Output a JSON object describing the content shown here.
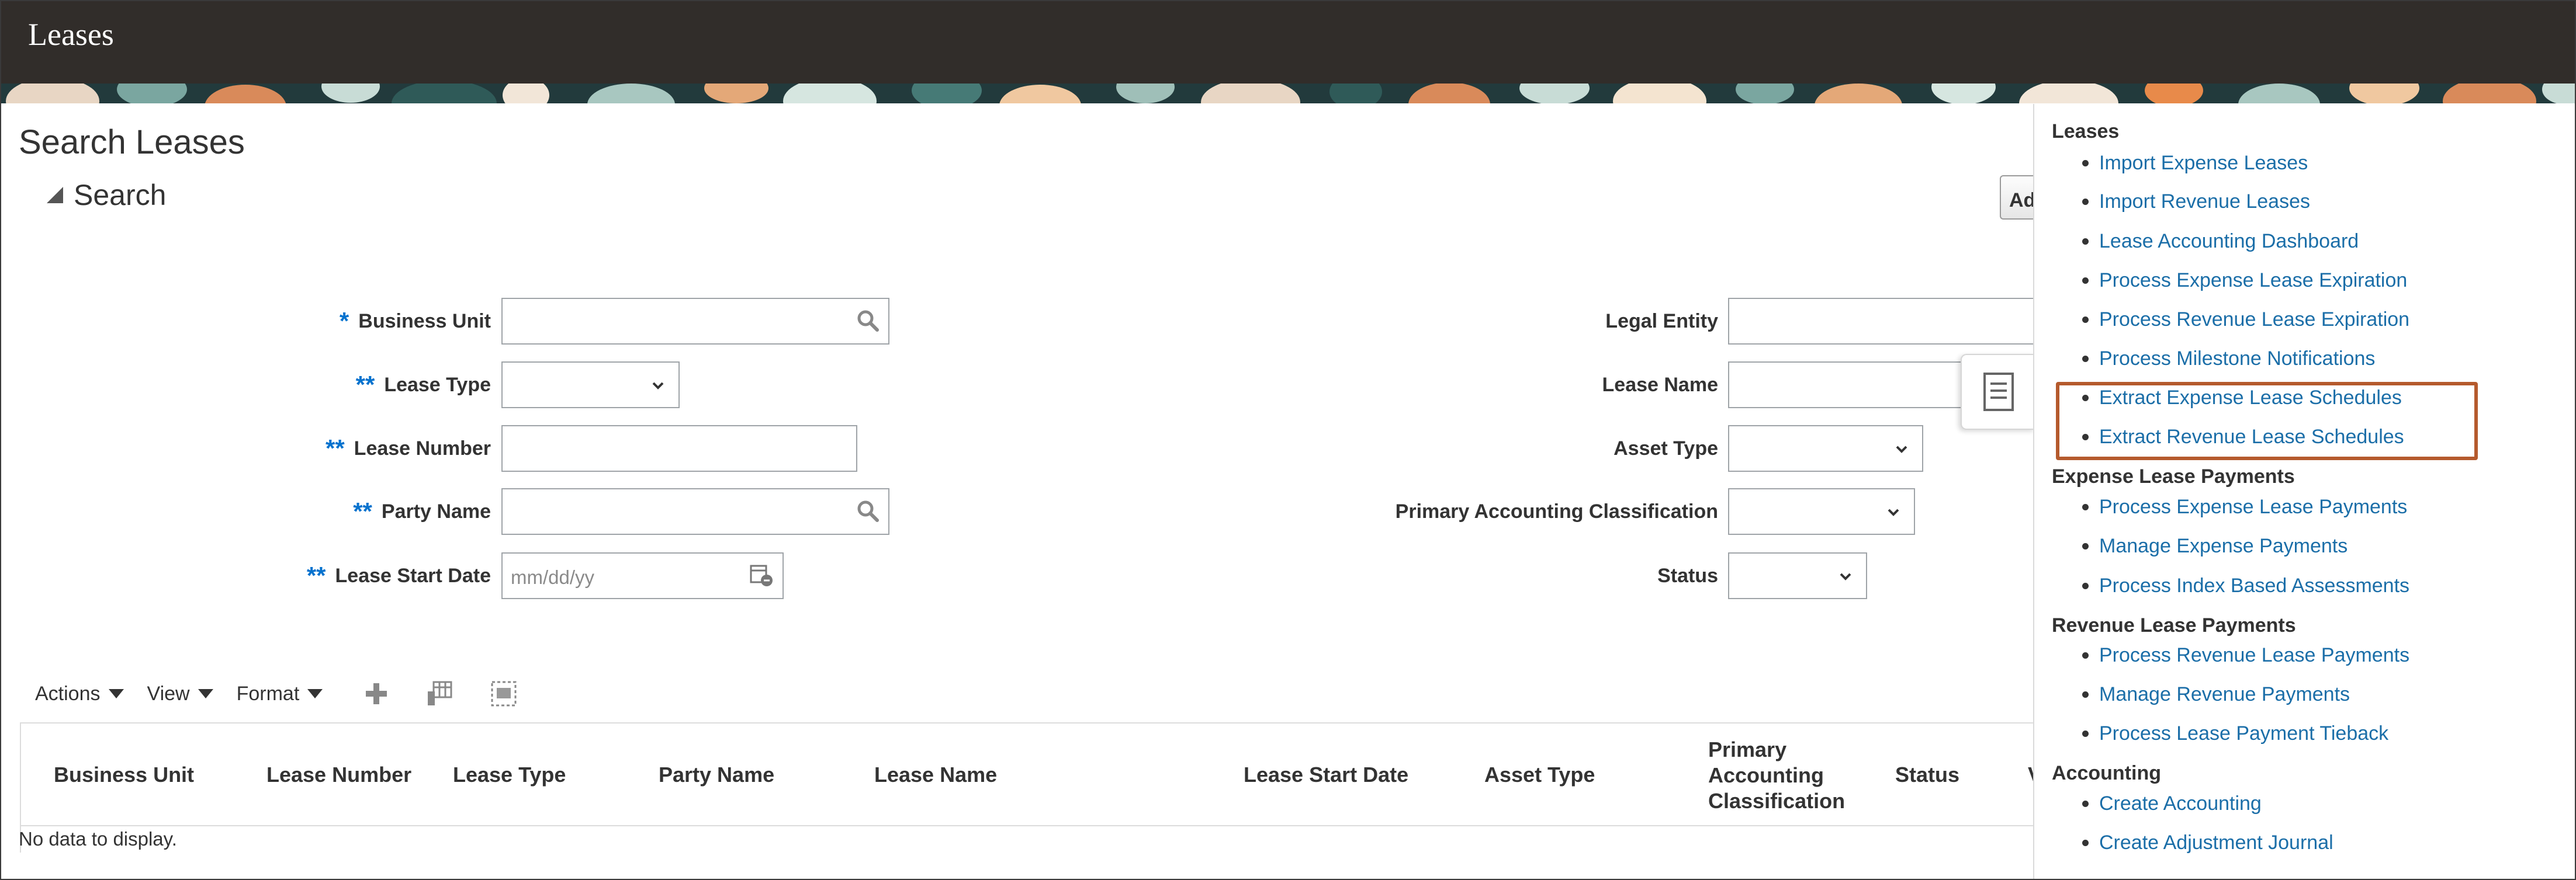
{
  "header": {
    "app_title": "Leases"
  },
  "page": {
    "title": "Search Leases",
    "search_section": "Search",
    "advanced_button_partial": "Ad"
  },
  "form": {
    "business_unit": {
      "label": "Business Unit",
      "required_marker": "*",
      "value": ""
    },
    "lease_type": {
      "label": "Lease Type",
      "required_marker": "**",
      "value": ""
    },
    "lease_number": {
      "label": "Lease Number",
      "required_marker": "**",
      "value": ""
    },
    "party_name": {
      "label": "Party Name",
      "required_marker": "**",
      "value": ""
    },
    "lease_start_date": {
      "label": "Lease Start Date",
      "required_marker": "**",
      "placeholder": "mm/dd/yy",
      "value": ""
    },
    "legal_entity": {
      "label": "Legal Entity",
      "value": ""
    },
    "lease_name": {
      "label": "Lease Name",
      "value": ""
    },
    "asset_type": {
      "label": "Asset Type",
      "value": ""
    },
    "primary_accounting_classification": {
      "label": "Primary Accounting Classification",
      "value": ""
    },
    "status": {
      "label": "Status",
      "value": ""
    }
  },
  "toolbar": {
    "actions": "Actions",
    "view": "View",
    "format": "Format"
  },
  "table": {
    "columns": [
      "Business Unit",
      "Lease Number",
      "Lease Type",
      "Party Name",
      "Lease Name",
      "Lease Start Date",
      "Asset Type",
      "Primary\nAccounting\nClassification",
      "Status",
      "V"
    ],
    "empty_text": "No data to display."
  },
  "tasks_panel": {
    "sections": [
      {
        "title": "Leases",
        "links": [
          "Import Expense Leases",
          "Import Revenue Leases",
          "Lease Accounting Dashboard",
          "Process Expense Lease Expiration",
          "Process Revenue Lease Expiration",
          "Process Milestone Notifications",
          "Extract Expense Lease Schedules",
          "Extract Revenue Lease Schedules"
        ]
      },
      {
        "title": "Expense Lease Payments",
        "links": [
          "Process Expense Lease Payments",
          "Manage Expense Payments",
          "Process Index Based Assessments"
        ]
      },
      {
        "title": "Revenue Lease Payments",
        "links": [
          "Process Revenue Lease Payments",
          "Manage Revenue Payments",
          "Process Lease Payment Tieback"
        ]
      },
      {
        "title": "Accounting",
        "links": [
          "Create Accounting",
          "Create Adjustment Journal"
        ]
      }
    ]
  },
  "colors": {
    "header_bg": "#312d2a",
    "link": "#1b6ea8",
    "required": "#0572ce",
    "highlight": "#b55a2d"
  },
  "icons": [
    "search-icon",
    "chevron-down-icon",
    "calendar-icon",
    "add-icon",
    "freeze-columns-icon",
    "detach-icon",
    "document-icon",
    "collapse-triangle-icon"
  ]
}
